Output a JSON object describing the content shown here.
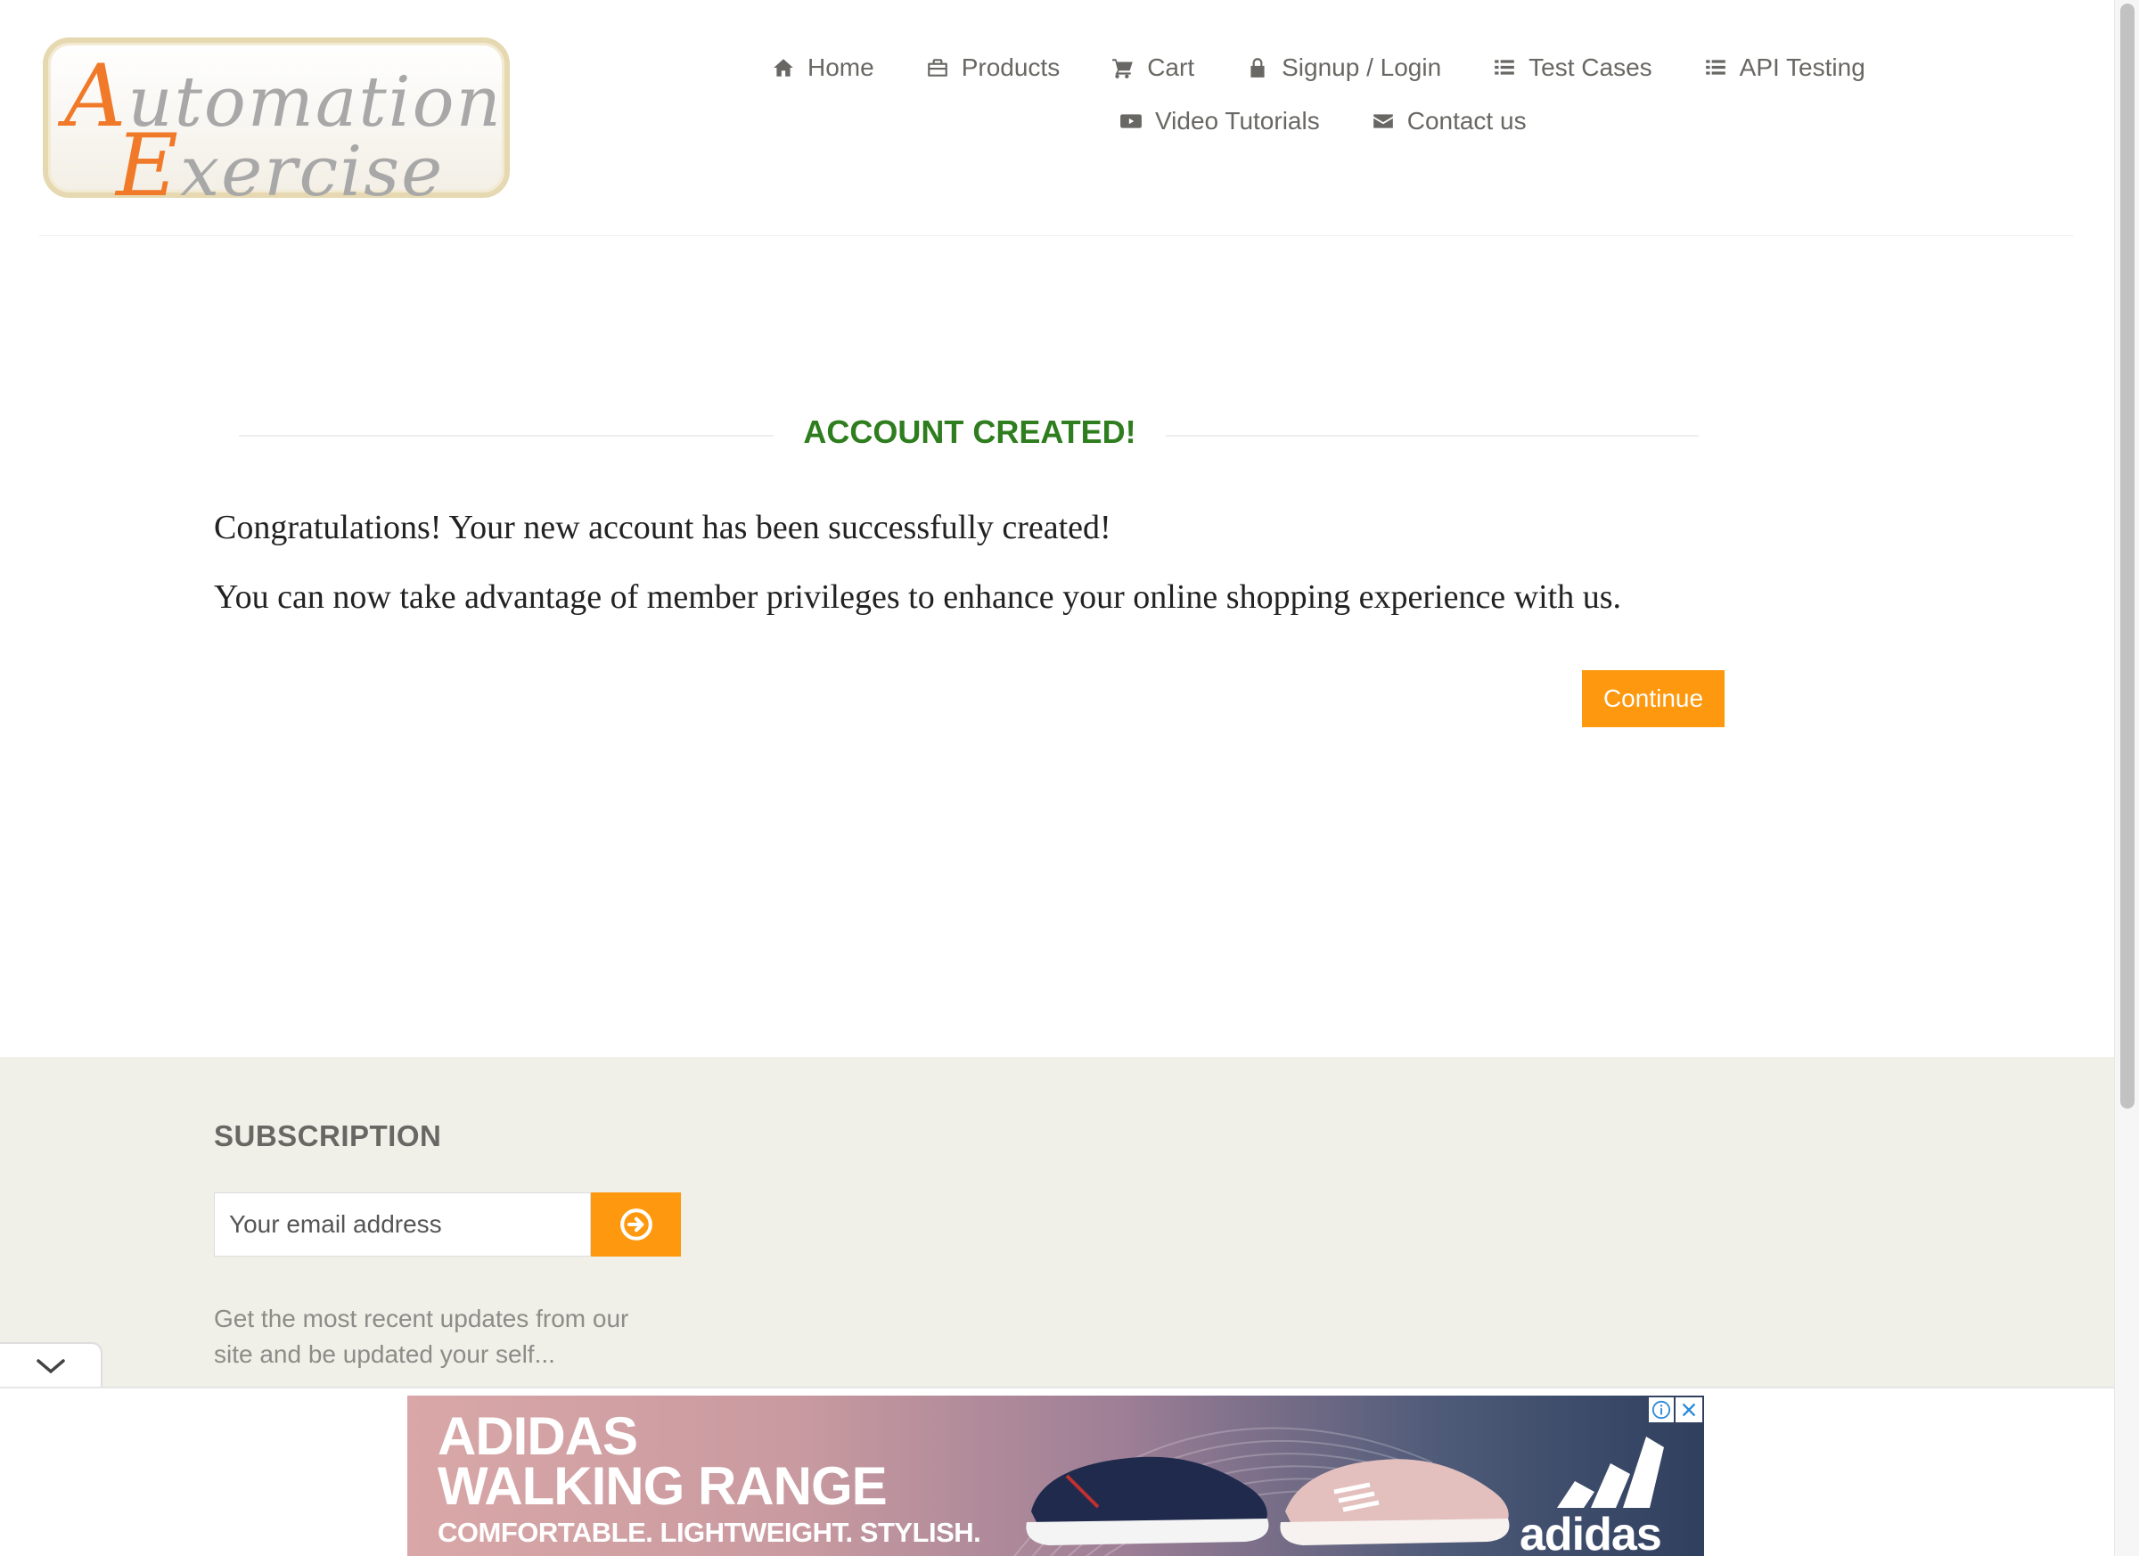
{
  "logo": {
    "line1_cap": "A",
    "line1_rest": "utomation",
    "line2_cap": "E",
    "line2_rest": "xercise"
  },
  "nav": {
    "items": [
      {
        "label": "Home",
        "icon": "home-icon"
      },
      {
        "label": "Products",
        "icon": "briefcase-icon"
      },
      {
        "label": "Cart",
        "icon": "cart-icon"
      },
      {
        "label": "Signup / Login",
        "icon": "lock-icon"
      },
      {
        "label": "Test Cases",
        "icon": "list-icon"
      },
      {
        "label": "API Testing",
        "icon": "list-icon"
      },
      {
        "label": "Video Tutorials",
        "icon": "youtube-play-icon"
      },
      {
        "label": "Contact us",
        "icon": "envelope-icon"
      }
    ]
  },
  "main": {
    "title": "ACCOUNT CREATED!",
    "message1": "Congratulations! Your new account has been successfully created!",
    "message2": "You can now take advantage of member privileges to enhance your online shopping experience with us.",
    "continue_label": "Continue"
  },
  "footer": {
    "subscription_title": "SUBSCRIPTION",
    "email_placeholder": "Your email address",
    "description": "Get the most recent updates from our site and be updated your self..."
  },
  "ad": {
    "line1": "ADIDAS",
    "line2": "WALKING RANGE",
    "line3": "COMFORTABLE. LIGHTWEIGHT. STYLISH.",
    "brand": "adidas"
  },
  "colors": {
    "accent": "#fe980f",
    "title_green": "#2e7d1e",
    "footer_bg": "#f0f0e9",
    "nav_text": "#696763"
  }
}
